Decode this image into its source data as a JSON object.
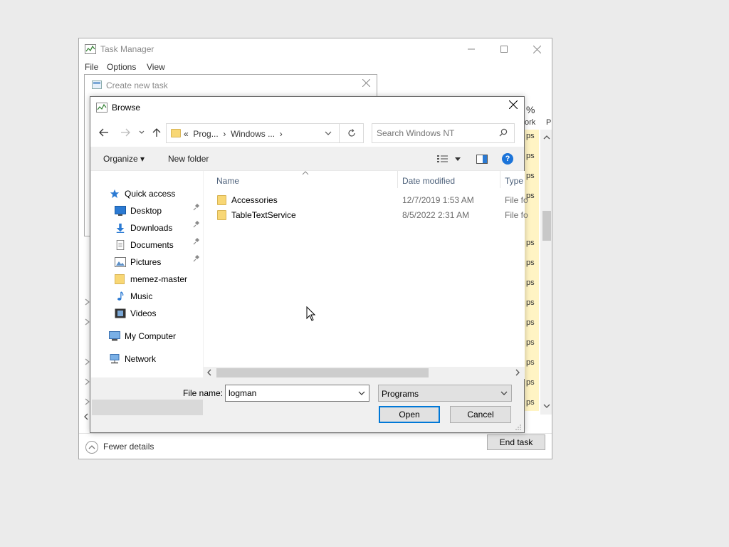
{
  "task_manager": {
    "title": "Task Manager",
    "menu": [
      "File",
      "Options",
      "View"
    ],
    "partial_headers": {
      "percent": "%",
      "network": "ork",
      "p": "P"
    },
    "partial_cells": [
      "ps",
      "ps",
      "ps",
      "ps",
      "ps",
      "ps",
      "ps",
      "ps",
      "ps",
      "ps",
      "ps",
      "ps",
      "ps"
    ],
    "footer": {
      "fewer_details": "Fewer details",
      "end_task": "End task"
    }
  },
  "create_new_task": {
    "title": "Create new task"
  },
  "browse": {
    "title": "Browse",
    "address": {
      "overflow": "«",
      "crumb1": "Prog...",
      "sep": "›",
      "crumb2": "Windows ...",
      "sep2": "›"
    },
    "search_placeholder": "Search Windows NT",
    "toolbar": {
      "organize": "Organize ▾",
      "new_folder": "New folder",
      "help": "?"
    },
    "nav": {
      "quick_access": "Quick access",
      "desktop": "Desktop",
      "downloads": "Downloads",
      "documents": "Documents",
      "pictures": "Pictures",
      "memez": "memez-master",
      "music": "Music",
      "videos": "Videos",
      "my_computer": "My Computer",
      "network": "Network"
    },
    "columns": {
      "name": "Name",
      "date": "Date modified",
      "type": "Type"
    },
    "files": [
      {
        "name": "Accessories",
        "date": "12/7/2019 1:53 AM",
        "type": "File fo"
      },
      {
        "name": "TableTextService",
        "date": "8/5/2022 2:31 AM",
        "type": "File fo"
      }
    ],
    "file_name_label": "File name:",
    "file_name_value": "logman",
    "file_type": "Programs",
    "open": "Open",
    "cancel": "Cancel"
  }
}
